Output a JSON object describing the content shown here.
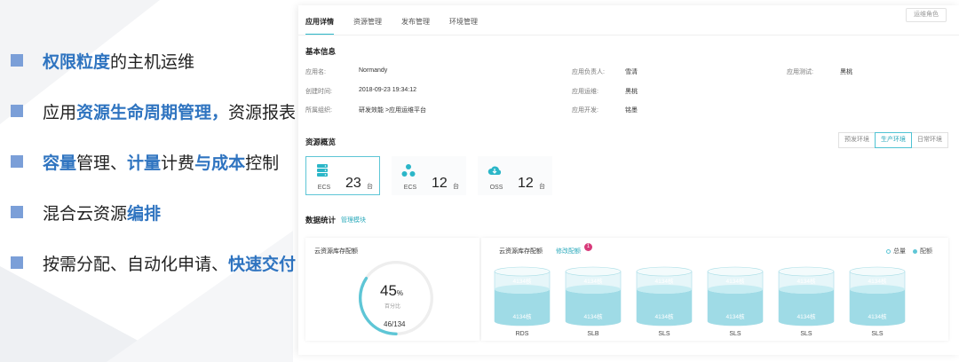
{
  "bullets": [
    {
      "parts": [
        {
          "t": "权限粒度",
          "h": true
        },
        {
          "t": "的主机运维",
          "h": false
        }
      ]
    },
    {
      "parts": [
        {
          "t": "应用",
          "h": false
        },
        {
          "t": "资源生命周期管理，",
          "h": true
        },
        {
          "t": "资源报表",
          "h": false
        }
      ]
    },
    {
      "parts": [
        {
          "t": "容量",
          "h": true
        },
        {
          "t": "管理、",
          "h": false
        },
        {
          "t": "计量",
          "h": true
        },
        {
          "t": "计费",
          "h": false
        },
        {
          "t": "与成本",
          "h": true
        },
        {
          "t": "控制",
          "h": false
        }
      ]
    },
    {
      "parts": [
        {
          "t": "混合云资源",
          "h": false
        },
        {
          "t": "编排",
          "h": true
        }
      ]
    },
    {
      "parts": [
        {
          "t": "按需分配、自动化申请、",
          "h": false
        },
        {
          "t": "快速交付",
          "h": true
        }
      ]
    }
  ],
  "panel": {
    "role_button": "运维角色",
    "tabs": [
      "应用详情",
      "资源管理",
      "发布管理",
      "环境管理"
    ],
    "basic_title": "基本信息",
    "basic": [
      {
        "k": "应用名:",
        "v": "Normandy"
      },
      {
        "k": "创建时间:",
        "v": "2018-09-23 19:34:12"
      },
      {
        "k": "所属组织:",
        "v": "研发效能 >应用运维平台"
      },
      {
        "k": "应用负责人:",
        "v": "雪清"
      },
      {
        "k": "应用运维:",
        "v": "黑桃"
      },
      {
        "k": "应用开发:",
        "v": "铭墨"
      },
      {
        "k": "应用测试:",
        "v": "黑桃"
      }
    ],
    "overview_title": "资源概览",
    "envs": [
      "预发环境",
      "生产环境",
      "日常环境"
    ],
    "resources": [
      {
        "label": "ECS",
        "value": "23",
        "unit": "台",
        "icon": "server-icon"
      },
      {
        "label": "ECS",
        "value": "12",
        "unit": "台",
        "icon": "cluster-icon"
      },
      {
        "label": "OSS",
        "value": "12",
        "unit": "台",
        "icon": "cloud-icon"
      }
    ],
    "stats_title": "数据统计",
    "stats_link": "管理模块",
    "gauge_card": {
      "title": "云资源库存配额",
      "percent": "45",
      "percent_sign": "%",
      "sub": "百分比",
      "ratio": "46/134",
      "fraction": 0.343
    },
    "cyl_card": {
      "title": "云资源库存配额",
      "link": "修改配额",
      "badge": "1",
      "legend": [
        "总量",
        "配额"
      ],
      "items": [
        {
          "name": "RDS",
          "top": "4134",
          "top_unit": "核",
          "bottom": "4134",
          "bottom_unit": "核"
        },
        {
          "name": "SLB",
          "top": "4134",
          "top_unit": "核",
          "bottom": "4134",
          "bottom_unit": "核"
        },
        {
          "name": "SLS",
          "top": "4134",
          "top_unit": "核",
          "bottom": "4134",
          "bottom_unit": "核"
        },
        {
          "name": "SLS",
          "top": "4134",
          "top_unit": "核",
          "bottom": "4134",
          "bottom_unit": "核"
        },
        {
          "name": "SLS",
          "top": "4134",
          "top_unit": "核",
          "bottom": "4134",
          "bottom_unit": "核"
        },
        {
          "name": "SLS",
          "top": "4134",
          "top_unit": "核",
          "bottom": "4134",
          "bottom_unit": "核"
        }
      ]
    }
  },
  "colors": {
    "accent": "#2bb6c8",
    "highlight": "#2f74c0",
    "bullet": "#7b9fd8",
    "badge": "#d83a7a"
  }
}
